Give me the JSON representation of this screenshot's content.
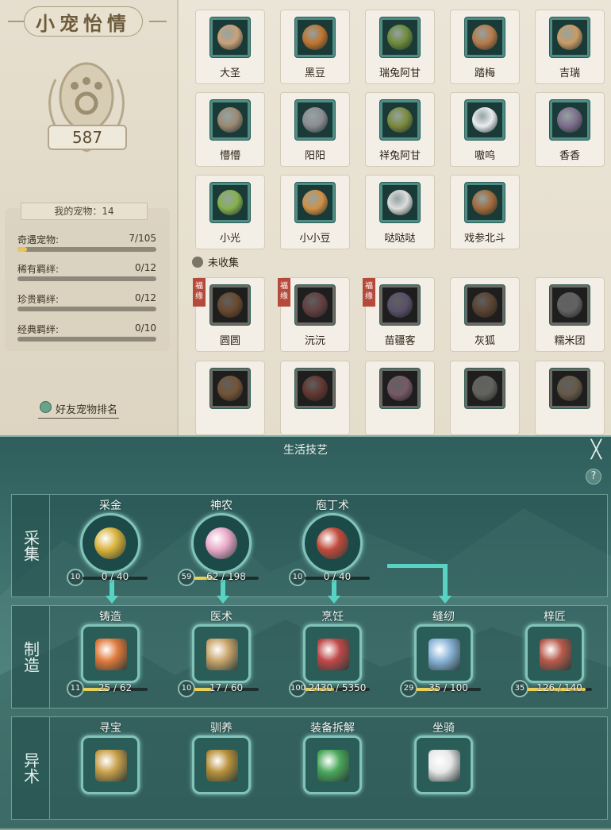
{
  "panel": {
    "title": "小宠怡情",
    "total": "587",
    "my_pets_label": "我的宠物：14",
    "stats": [
      {
        "label": "奇遇宠物:",
        "value": "7/105",
        "progress": 0.067
      },
      {
        "label": "稀有羁绊:",
        "value": "0/12",
        "progress": 0
      },
      {
        "label": "珍贵羁绊:",
        "value": "0/12",
        "progress": 0
      },
      {
        "label": "经典羁绊:",
        "value": "0/10",
        "progress": 0
      }
    ],
    "friend_rank": "好友宠物排名"
  },
  "collected": [
    {
      "name": "大圣",
      "color": "#c9a27a"
    },
    {
      "name": "黑豆",
      "color": "#c0742e"
    },
    {
      "name": "瑞兔阿甘",
      "color": "#6e8a3a"
    },
    {
      "name": "踏梅",
      "color": "#b87a4a"
    },
    {
      "name": "吉瑞",
      "color": "#c99b64"
    },
    {
      "name": "懵懵",
      "color": "#9b8a74"
    },
    {
      "name": "阳阳",
      "color": "#8b8d92"
    },
    {
      "name": "祥兔阿甘",
      "color": "#7b8a3c"
    },
    {
      "name": "嗷呜",
      "color": "#e9ecef"
    },
    {
      "name": "香香",
      "color": "#7d6e8c"
    },
    {
      "name": "小光",
      "color": "#86b04c"
    },
    {
      "name": "小小豆",
      "color": "#d09046"
    },
    {
      "name": "哒哒哒",
      "color": "#dcdcdc"
    },
    {
      "name": "戏参北斗",
      "color": "#a36a3a"
    }
  ],
  "uncollected_label": "未收集",
  "uncollected": [
    {
      "name": "圆圆",
      "tag": "福缘",
      "color": "#a86c3a"
    },
    {
      "name": "沅沅",
      "tag": "福缘",
      "color": "#9a5a5a"
    },
    {
      "name": "苗疆客",
      "tag": "福缘",
      "color": "#8a7aa8"
    },
    {
      "name": "灰狐",
      "tag": "",
      "color": "#8a6040"
    },
    {
      "name": "糯米团",
      "tag": "",
      "color": "#9a9a9a"
    },
    {
      "name": "",
      "tag": "",
      "color": "#b88048"
    },
    {
      "name": "",
      "tag": "",
      "color": "#9a4a40"
    },
    {
      "name": "",
      "tag": "",
      "color": "#c08aa0"
    },
    {
      "name": "",
      "tag": "",
      "color": "#9a9a94"
    },
    {
      "name": "",
      "tag": "",
      "color": "#a08a6a"
    }
  ],
  "life_skills": {
    "title": "生活技艺",
    "close": "╳",
    "help": "?",
    "rows": [
      {
        "label": "采集",
        "skills": [
          {
            "name": "采金",
            "level": "10",
            "progress_text": "0 / 40",
            "progress": 0,
            "color": "#d9b23a"
          },
          {
            "name": "神农",
            "level": "59",
            "progress_text": "62 / 198",
            "progress": 0.31,
            "color": "#e8a8c8"
          },
          {
            "name": "庖丁术",
            "level": "10",
            "progress_text": "0 / 40",
            "progress": 0,
            "color": "#c04a3a"
          }
        ]
      },
      {
        "label": "制造",
        "skills": [
          {
            "name": "铸造",
            "level": "11",
            "progress_text": "25 / 62",
            "progress": 0.4,
            "color": "#e07a3a"
          },
          {
            "name": "医术",
            "level": "10",
            "progress_text": "17 / 60",
            "progress": 0.28,
            "color": "#c9a46a"
          },
          {
            "name": "烹饪",
            "level": "100",
            "progress_text": "2430 / 5350",
            "progress": 0.45,
            "color": "#c04848"
          },
          {
            "name": "缝纫",
            "level": "29",
            "progress_text": "35 / 100",
            "progress": 0.35,
            "color": "#8ab4d8"
          },
          {
            "name": "梓匠",
            "level": "35",
            "progress_text": "126 / 140",
            "progress": 0.9,
            "color": "#b85a4a"
          }
        ]
      },
      {
        "label": "异术",
        "skills": [
          {
            "name": "寻宝",
            "color": "#c9a04a"
          },
          {
            "name": "驯养",
            "color": "#b8903a"
          },
          {
            "name": "装备拆解",
            "color": "#4aa85a"
          },
          {
            "name": "坐骑",
            "color": "#e8e8e8"
          }
        ]
      }
    ]
  }
}
